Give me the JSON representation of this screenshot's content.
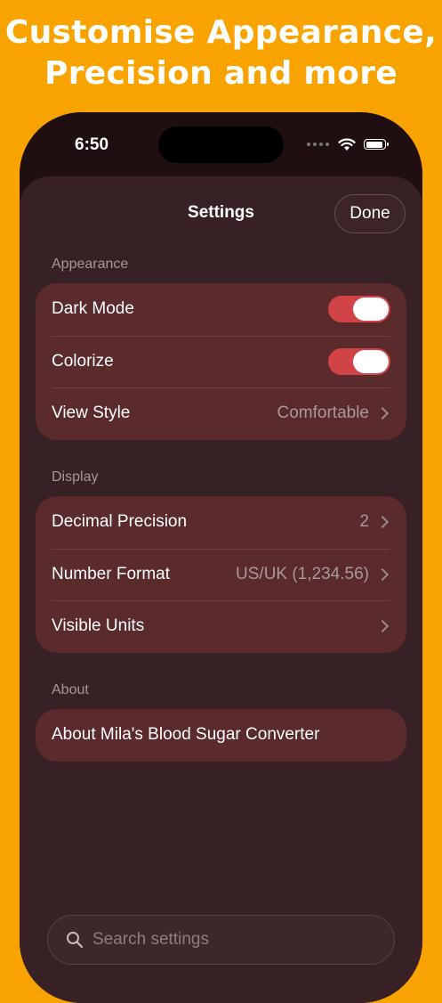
{
  "headline": {
    "line1": "Customise Appearance,",
    "line2": "Precision and more"
  },
  "status_bar": {
    "time": "6:50"
  },
  "sheet": {
    "title": "Settings",
    "done_label": "Done"
  },
  "appearance": {
    "section_label": "Appearance",
    "dark_mode_label": "Dark Mode",
    "dark_mode_on": true,
    "colorize_label": "Colorize",
    "colorize_on": true,
    "view_style_label": "View Style",
    "view_style_value": "Comfortable"
  },
  "display": {
    "section_label": "Display",
    "decimal_precision_label": "Decimal Precision",
    "decimal_precision_value": "2",
    "number_format_label": "Number Format",
    "number_format_value": "US/UK (1,234.56)",
    "visible_units_label": "Visible Units"
  },
  "about": {
    "section_label": "About",
    "about_label": "About Mila's Blood Sugar Converter"
  },
  "search": {
    "placeholder": "Search settings"
  },
  "colors": {
    "background": "#F9A300",
    "sheet": "#372124",
    "group": "#5a2a2d",
    "toggle_on": "#d14347"
  }
}
